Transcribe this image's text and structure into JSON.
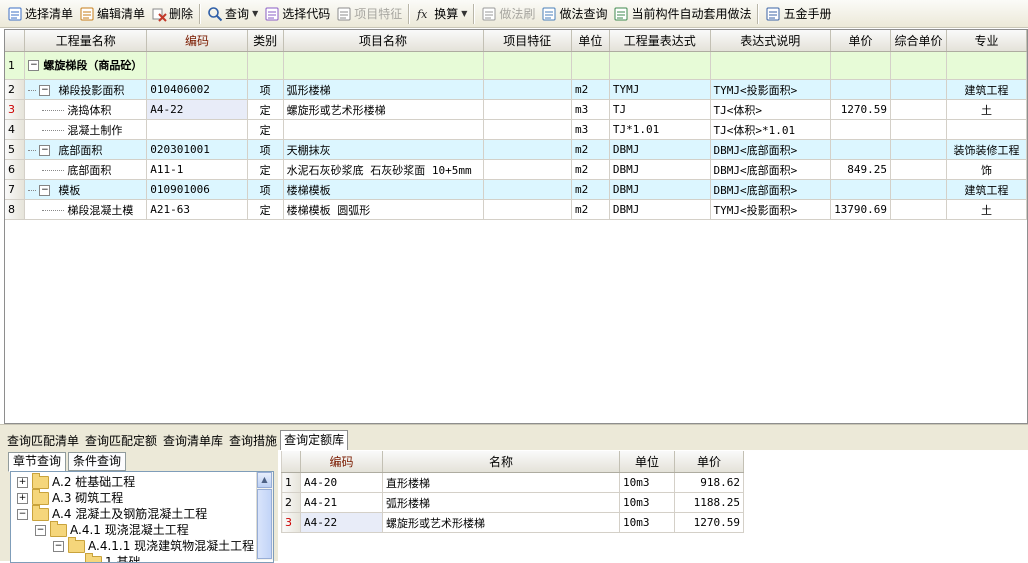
{
  "toolbar": {
    "items": [
      {
        "label": "选择清单",
        "icon": "select-list-icon",
        "disabled": false,
        "caret": false
      },
      {
        "label": "编辑清单",
        "icon": "edit-list-icon",
        "disabled": false,
        "caret": false
      },
      {
        "label": "删除",
        "icon": "delete-icon",
        "disabled": false,
        "caret": false
      },
      {
        "label": "查询",
        "icon": "search-icon",
        "disabled": false,
        "caret": true
      },
      {
        "label": "选择代码",
        "icon": "select-code-icon",
        "disabled": false,
        "caret": false
      },
      {
        "label": "项目特征",
        "icon": "project-feature-icon",
        "disabled": true,
        "caret": false
      },
      {
        "label": "换算",
        "icon": "fx-icon",
        "disabled": false,
        "caret": true
      },
      {
        "label": "做法刷",
        "icon": "brush-icon",
        "disabled": true,
        "caret": false
      },
      {
        "label": "做法查询",
        "icon": "method-query-icon",
        "disabled": false,
        "caret": false
      },
      {
        "label": "当前构件自动套用做法",
        "icon": "auto-apply-icon",
        "disabled": false,
        "caret": false
      },
      {
        "label": "五金手册",
        "icon": "hardware-manual-icon",
        "disabled": false,
        "caret": false
      }
    ]
  },
  "main_grid": {
    "columns": [
      "",
      "工程量名称",
      "编码",
      "类别",
      "项目名称",
      "项目特征",
      "单位",
      "工程量表达式",
      "表达式说明",
      "单价",
      "综合单价",
      "专业"
    ],
    "rows": [
      {
        "num": "1",
        "kind": "title",
        "name": "螺旋梯段（商品砼）",
        "code": "",
        "cat": "",
        "proj": "",
        "feat": "",
        "unit": "",
        "expr": "",
        "desc": "",
        "price": "",
        "comp": "",
        "major": ""
      },
      {
        "num": "2",
        "kind": "qd",
        "name": "梯段投影面积",
        "code": "010406002",
        "cat": "项",
        "proj": "弧形楼梯",
        "feat": "",
        "unit": "m2",
        "expr": "TYMJ",
        "desc": "TYMJ<投影面积>",
        "price": "",
        "comp": "",
        "major": "建筑工程"
      },
      {
        "num": "3",
        "kind": "de",
        "name": "浇捣体积",
        "code": "A4-22",
        "cat": "定",
        "proj": "螺旋形或艺术形楼梯",
        "feat": "",
        "unit": "m3",
        "expr": "TJ",
        "desc": "TJ<体积>",
        "price": "1270.59",
        "comp": "",
        "major": "土"
      },
      {
        "num": "4",
        "kind": "de",
        "name": "混凝土制作",
        "code": "",
        "cat": "定",
        "proj": "",
        "feat": "",
        "unit": "m3",
        "expr": "TJ*1.01",
        "desc": "TJ<体积>*1.01",
        "price": "",
        "comp": "",
        "major": ""
      },
      {
        "num": "5",
        "kind": "qd",
        "name": "底部面积",
        "code": "020301001",
        "cat": "项",
        "proj": "天棚抹灰",
        "feat": "",
        "unit": "m2",
        "expr": "DBMJ",
        "desc": "DBMJ<底部面积>",
        "price": "",
        "comp": "",
        "major": "装饰装修工程"
      },
      {
        "num": "6",
        "kind": "de",
        "name": "底部面积",
        "code": "A11-1",
        "cat": "定",
        "proj": "水泥石灰砂浆底 石灰砂浆面 10+5mm",
        "feat": "",
        "unit": "m2",
        "expr": "DBMJ",
        "desc": "DBMJ<底部面积>",
        "price": "849.25",
        "comp": "",
        "major": "饰"
      },
      {
        "num": "7",
        "kind": "qd",
        "name": "模板",
        "code": "010901006",
        "cat": "项",
        "proj": "楼梯模板",
        "feat": "",
        "unit": "m2",
        "expr": "DBMJ",
        "desc": "DBMJ<底部面积>",
        "price": "",
        "comp": "",
        "major": "建筑工程"
      },
      {
        "num": "8",
        "kind": "de",
        "name": "梯段混凝土模",
        "code": "A21-63",
        "cat": "定",
        "proj": "楼梯模板 圆弧形",
        "feat": "",
        "unit": "m2",
        "expr": "DBMJ",
        "desc": "TYMJ<投影面积>",
        "price": "13790.69",
        "comp": "",
        "major": "土"
      }
    ]
  },
  "bottom_tabs": [
    "查询匹配清单",
    "查询匹配定额",
    "查询清单库",
    "查询措施",
    "查询定额库"
  ],
  "bottom_active_tab": 4,
  "left_tabs": [
    "章节查询",
    "条件查询"
  ],
  "tree": [
    {
      "label": "A.2 桩基础工程",
      "toggle": "+",
      "level": 0
    },
    {
      "label": "A.3 砌筑工程",
      "toggle": "+",
      "level": 0
    },
    {
      "label": "A.4 混凝土及钢筋混凝土工程",
      "toggle": "−",
      "level": 0
    },
    {
      "label": "A.4.1 现浇混凝土工程",
      "toggle": "−",
      "level": 1
    },
    {
      "label": "A.4.1.1 现浇建筑物混凝土工程",
      "toggle": "−",
      "level": 2
    },
    {
      "label": "1.基础",
      "toggle": "",
      "level": 3
    }
  ],
  "result_grid": {
    "columns": [
      "",
      "编码",
      "名称",
      "单位",
      "单价"
    ],
    "rows": [
      {
        "num": "1",
        "code": "A4-20",
        "name": "直形楼梯",
        "unit": "10m3",
        "price": "918.62"
      },
      {
        "num": "2",
        "code": "A4-21",
        "name": "弧形楼梯",
        "unit": "10m3",
        "price": "1188.25"
      },
      {
        "num": "3",
        "code": "A4-22",
        "name": "螺旋形或艺术形楼梯",
        "unit": "10m3",
        "price": "1270.59"
      }
    ]
  }
}
